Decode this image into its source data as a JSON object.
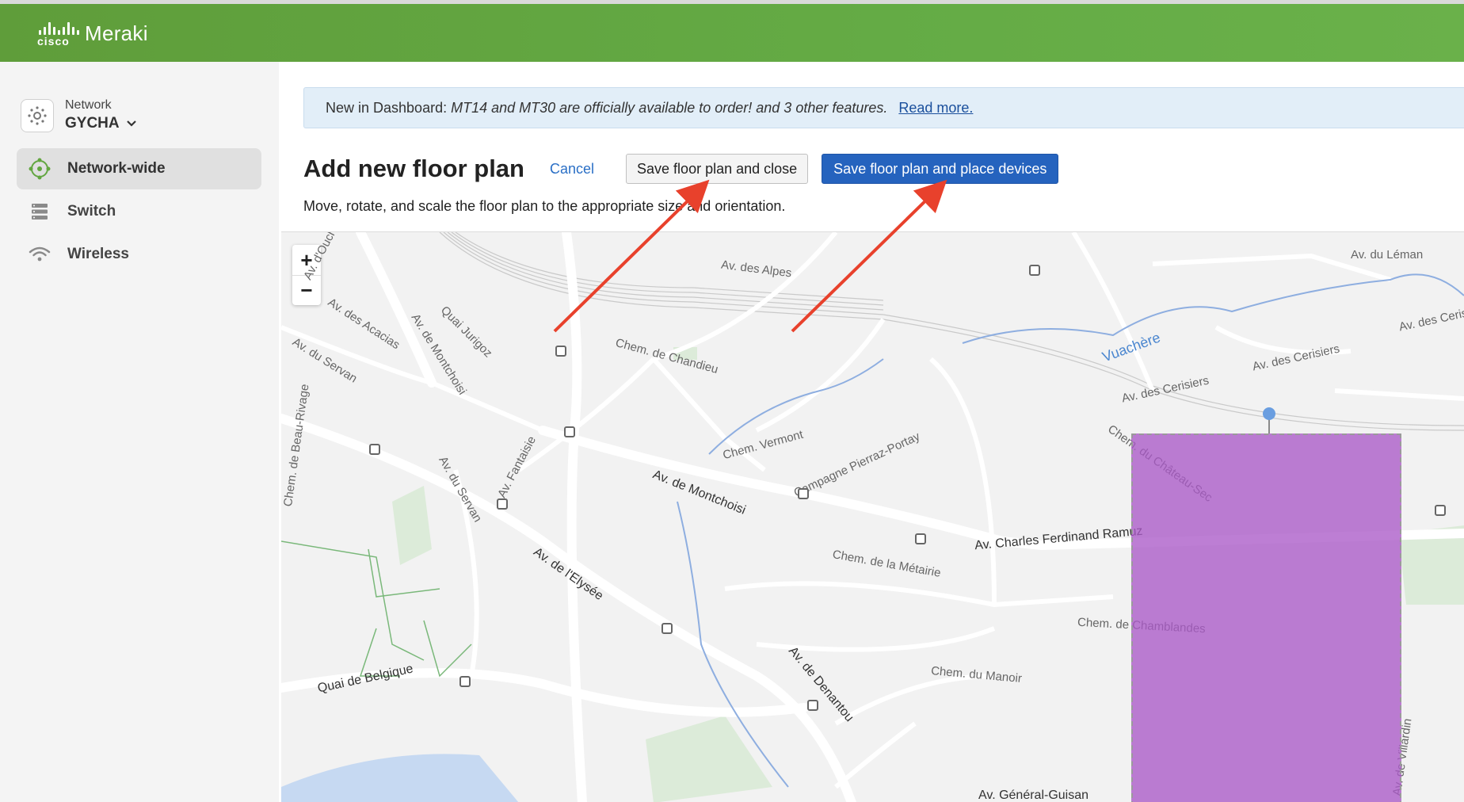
{
  "header": {
    "brand_small": "cisco",
    "brand_name": "Meraki"
  },
  "sidebar": {
    "network_label": "Network",
    "network_name": "GYCHA",
    "items": [
      {
        "label": "Network-wide",
        "icon": "network-wide-icon",
        "active": true
      },
      {
        "label": "Switch",
        "icon": "switch-icon",
        "active": false
      },
      {
        "label": "Wireless",
        "icon": "wireless-icon",
        "active": false
      }
    ]
  },
  "banner": {
    "prefix": "New in Dashboard:",
    "message": "MT14 and MT30 are officially available to order! and 3 other features.",
    "link": "Read more."
  },
  "page": {
    "title": "Add new floor plan",
    "cancel": "Cancel",
    "save_close": "Save floor plan and close",
    "save_place": "Save floor plan and place devices",
    "instructions": "Move, rotate, and scale the floor plan to the appropriate size and orientation."
  },
  "map": {
    "zoom_in": "+",
    "zoom_out": "−",
    "labels": {
      "ouchy": "Av. d'Ouchy",
      "alpes": "Av. des Alpes",
      "leman": "Av. du Léman",
      "acacias": "Av. des Acacias",
      "jurigoz": "Quai Jurigoz",
      "montchoisi_v": "Av. de Montchoisi",
      "servan1": "Av. du Servan",
      "chandieu": "Chem. de Chandieu",
      "vuachere": "Vuachère",
      "cerisiers1": "Av. des Cerisiers",
      "cerisiers2": "Av. des Cerisiers",
      "ceris_edge": "Av. des Cerisiers",
      "chateau_sec": "Chem. du Château-Sec",
      "vermont": "Chem. Vermont",
      "montchoisi": "Av. de Montchoisi",
      "pierraz": "Campagne Pierraz-Portay",
      "servan2": "Av. du Servan",
      "fantaisie": "Av. Fantaisie",
      "beau_rivage": "Chem. de Beau-Rivage",
      "elysee": "Av. de l'Elysée",
      "ramuz": "Av. Charles Ferdinand Ramuz",
      "metairie": "Chem. de la Métairie",
      "chamblandes": "Chem. de Chamblandes",
      "denantou": "Av. de Denantou",
      "manoir": "Chem. du Manoir",
      "belgique": "Quai de Belgique",
      "guisan": "Av. Général-Guisan",
      "villardin": "Av. de Villardin"
    }
  },
  "colors": {
    "header_green": "#64ab45",
    "primary_blue": "#2563be",
    "floorplan_purple": "#aa5ac8",
    "arrow_red": "#e8412c"
  }
}
